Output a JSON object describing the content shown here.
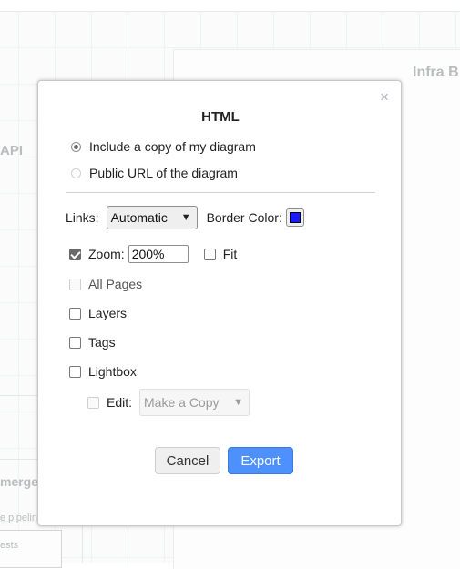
{
  "background": {
    "panel_title": "Infra B",
    "api_label": "API",
    "merge_label": "merge",
    "pipeline_label": "e pipelin",
    "tests_label": "ests"
  },
  "dialog": {
    "title": "HTML",
    "close_glyph": "×",
    "embed_options": [
      {
        "label": "Include a copy of my diagram",
        "selected": true
      },
      {
        "label": "Public URL of the diagram",
        "selected": false
      }
    ],
    "links": {
      "label": "Links:",
      "value": "Automatic"
    },
    "border_color": {
      "label": "Border Color:",
      "color": "#1a1aff"
    },
    "zoom": {
      "label": "Zoom:",
      "checked": true,
      "value": "200%"
    },
    "fit": {
      "label": "Fit",
      "checked": false
    },
    "all_pages": {
      "label": "All Pages",
      "checked": false,
      "disabled": true
    },
    "layers": {
      "label": "Layers",
      "checked": false
    },
    "tags": {
      "label": "Tags",
      "checked": false
    },
    "lightbox": {
      "label": "Lightbox",
      "checked": false
    },
    "edit": {
      "label": "Edit:",
      "checked": false,
      "disabled": true,
      "value": "Make a Copy"
    },
    "buttons": {
      "cancel": "Cancel",
      "export": "Export"
    }
  },
  "colors": {
    "accent": "#4d90fe",
    "border_color_swatch": "#1a1aff"
  }
}
